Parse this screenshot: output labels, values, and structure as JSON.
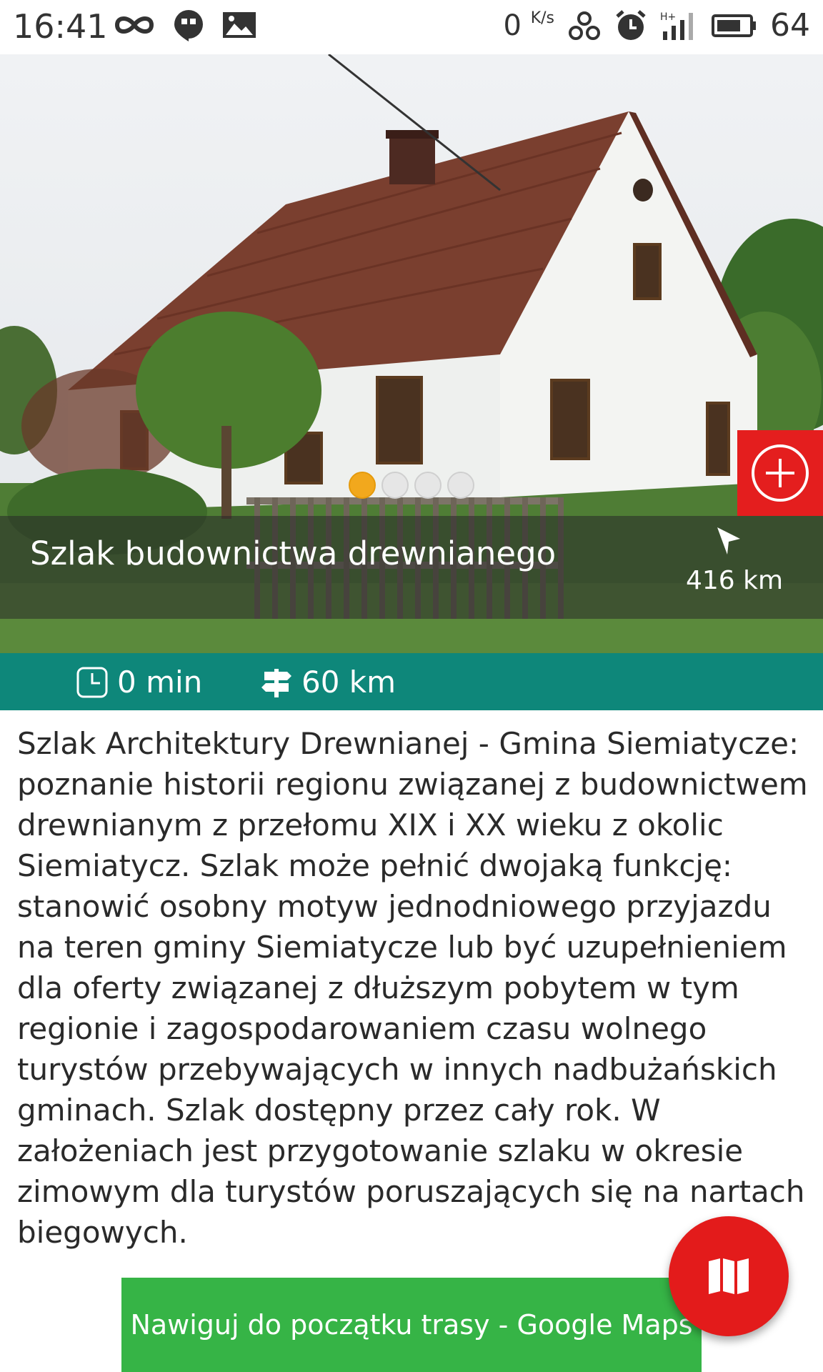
{
  "status_bar": {
    "time": "16:41",
    "network_speed": "0",
    "network_speed_unit": "K/s",
    "battery": "64"
  },
  "hero": {
    "title": "Szlak budownictwa drewnianego",
    "distance": "416 km",
    "carousel_count": 4,
    "carousel_active_index": 0
  },
  "info": {
    "duration": "0 min",
    "length": "60 km"
  },
  "description": "Szlak Architektury Drewnianej  - Gmina Siemiatycze: poznanie historii regionu związanej z budownictwem drewnianym z przełomu XIX i XX wieku z okolic Siemiatycz. Szlak może pełnić dwojaką funkcję: stanowić osobny motyw jednodniowego przyjazdu na teren gminy Siemiatycze lub być uzupełnieniem dla oferty związanej z dłuższym pobytem w tym regionie i zagospodarowaniem czasu wolnego turystów przebywających w innych nadbużańskich gminach. Szlak dostępny przez cały rok. W założeniach jest przygotowanie szlaku w okresie zimowym dla turystów poruszających się na nartach biegowych.",
  "buttons": {
    "navigate_label": "Nawiguj do początku trasy - Google Maps"
  },
  "colors": {
    "accent_teal": "#0e877a",
    "add_red": "#e41e1e",
    "fab_red": "#e31b1b",
    "button_green": "#36b446",
    "dot_active": "#f2a81d"
  }
}
